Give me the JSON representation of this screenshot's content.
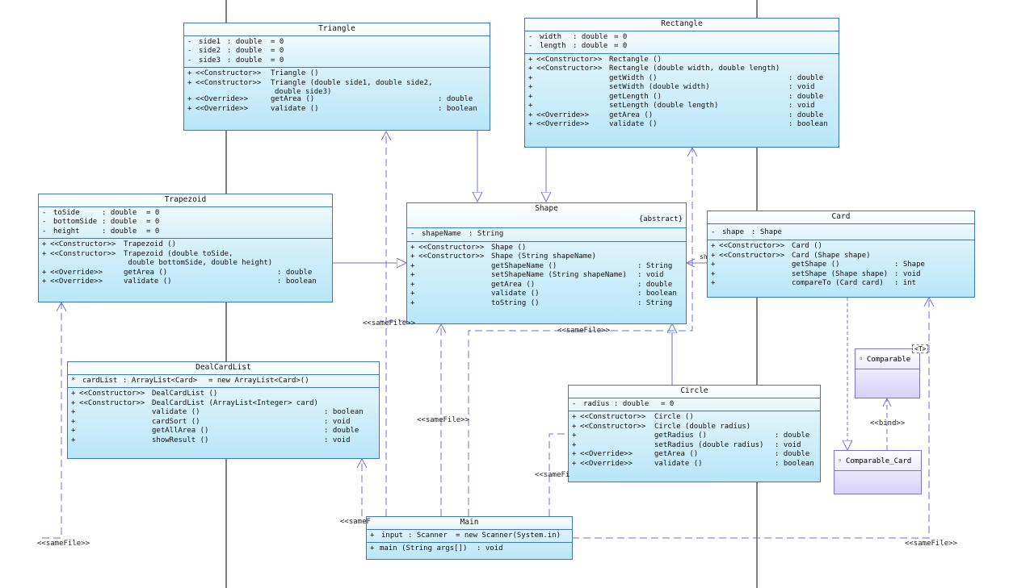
{
  "classes": {
    "triangle": {
      "name": "Triangle",
      "attributes": [
        {
          "vis": "-",
          "name": "side1",
          "type": ": double",
          "init": "= 0"
        },
        {
          "vis": "-",
          "name": "side2",
          "type": ": double",
          "init": "= 0"
        },
        {
          "vis": "-",
          "name": "side3",
          "type": ": double",
          "init": "= 0"
        }
      ],
      "operations": [
        {
          "vis": "+",
          "stereo": "<<Constructor>>",
          "sig": "Triangle ()",
          "ret": ""
        },
        {
          "vis": "+",
          "stereo": "<<Constructor>>",
          "sig": "Triangle (double side1, double side2,",
          "ret": ""
        },
        {
          "vis": "",
          "stereo": "",
          "sig": "double side3)",
          "ret": ""
        },
        {
          "vis": "+",
          "stereo": "<<Override>>",
          "sig": "getArea ()",
          "ret": ": double"
        },
        {
          "vis": "+",
          "stereo": "<<Override>>",
          "sig": "validate ()",
          "ret": ": boolean"
        }
      ]
    },
    "rectangle": {
      "name": "Rectangle",
      "attributes": [
        {
          "vis": "-",
          "name": "width",
          "type": ": double",
          "init": "= 0"
        },
        {
          "vis": "-",
          "name": "length",
          "type": ": double",
          "init": "= 0"
        }
      ],
      "operations": [
        {
          "vis": "+",
          "stereo": "<<Constructor>>",
          "sig": "Rectangle ()",
          "ret": ""
        },
        {
          "vis": "+",
          "stereo": "<<Constructor>>",
          "sig": "Rectangle (double width, double length)",
          "ret": ""
        },
        {
          "vis": "+",
          "stereo": "",
          "sig": "getWidth ()",
          "ret": ": double"
        },
        {
          "vis": "+",
          "stereo": "",
          "sig": "setWidth (double width)",
          "ret": ": void"
        },
        {
          "vis": "+",
          "stereo": "",
          "sig": "getLength ()",
          "ret": ": double"
        },
        {
          "vis": "+",
          "stereo": "",
          "sig": "setLength (double length)",
          "ret": ": void"
        },
        {
          "vis": "+",
          "stereo": "<<Override>>",
          "sig": "getArea ()",
          "ret": ": double"
        },
        {
          "vis": "+",
          "stereo": "<<Override>>",
          "sig": "validate ()",
          "ret": ": boolean"
        }
      ]
    },
    "trapezoid": {
      "name": "Trapezoid",
      "attributes": [
        {
          "vis": "-",
          "name": "toSide",
          "type": ": double",
          "init": "= 0"
        },
        {
          "vis": "-",
          "name": "bottomSide",
          "type": ": double",
          "init": "= 0"
        },
        {
          "vis": "-",
          "name": "height",
          "type": ": double",
          "init": "= 0"
        }
      ],
      "operations": [
        {
          "vis": "+",
          "stereo": "<<Constructor>>",
          "sig": "Trapezoid ()",
          "ret": ""
        },
        {
          "vis": "+",
          "stereo": "<<Constructor>>",
          "sig": "Trapezoid (double toSide,",
          "ret": ""
        },
        {
          "vis": "",
          "stereo": "",
          "sig": " double bottomSide, double height)",
          "ret": ""
        },
        {
          "vis": "+",
          "stereo": "<<Override>>",
          "sig": "getArea ()",
          "ret": ": double"
        },
        {
          "vis": "+",
          "stereo": "<<Override>>",
          "sig": "validate ()",
          "ret": ": boolean"
        }
      ]
    },
    "shape": {
      "name": "Shape",
      "abstract": "{abstract}",
      "attributes": [
        {
          "vis": "-",
          "name": "shapeName",
          "type": ": String",
          "init": ""
        }
      ],
      "operations": [
        {
          "vis": "+",
          "stereo": "<<Constructor>>",
          "sig": "Shape ()",
          "ret": ""
        },
        {
          "vis": "+",
          "stereo": "<<Constructor>>",
          "sig": "Shape (String shapeName)",
          "ret": ""
        },
        {
          "vis": "+",
          "stereo": "",
          "sig": "getShapeName ()",
          "ret": ": String"
        },
        {
          "vis": "+",
          "stereo": "",
          "sig": "setShapeName (String shapeName)",
          "ret": ": void"
        },
        {
          "vis": "+",
          "stereo": "",
          "sig": "getArea ()",
          "ret": ": double"
        },
        {
          "vis": "+",
          "stereo": "",
          "sig": "validate ()",
          "ret": ": boolean"
        },
        {
          "vis": "+",
          "stereo": "",
          "sig": "toString ()",
          "ret": ": String"
        }
      ]
    },
    "card": {
      "name": "Card",
      "attributes": [
        {
          "vis": "-",
          "name": "shape",
          "type": ": Shape",
          "init": ""
        }
      ],
      "operations": [
        {
          "vis": "+",
          "stereo": "<<Constructor>>",
          "sig": "Card ()",
          "ret": ""
        },
        {
          "vis": "+",
          "stereo": "<<Constructor>>",
          "sig": "Card (Shape shape)",
          "ret": ""
        },
        {
          "vis": "+",
          "stereo": "",
          "sig": "getShape ()",
          "ret": ": Shape"
        },
        {
          "vis": "+",
          "stereo": "",
          "sig": "setShape (Shape shape)",
          "ret": ": void"
        },
        {
          "vis": "+",
          "stereo": "",
          "sig": "compareTo (Card card)",
          "ret": ": int"
        }
      ]
    },
    "dealcardlist": {
      "name": "DealCardList",
      "attributes": [
        {
          "vis": "*",
          "name": "cardList",
          "type": ": ArrayList<Card>",
          "init": "= new ArrayList<Card>()"
        }
      ],
      "operations": [
        {
          "vis": "+",
          "stereo": "<<Constructor>>",
          "sig": "DealCardList ()",
          "ret": ""
        },
        {
          "vis": "+",
          "stereo": "<<Constructor>>",
          "sig": "DealCardList (ArrayList<Integer> card)",
          "ret": ""
        },
        {
          "vis": "+",
          "stereo": "",
          "sig": "validate ()",
          "ret": ": boolean"
        },
        {
          "vis": "+",
          "stereo": "",
          "sig": "cardSort ()",
          "ret": ": void"
        },
        {
          "vis": "+",
          "stereo": "",
          "sig": "getAllArea ()",
          "ret": ": double"
        },
        {
          "vis": "+",
          "stereo": "",
          "sig": "showResult ()",
          "ret": ": void"
        }
      ]
    },
    "circle": {
      "name": "Circle",
      "attributes": [
        {
          "vis": "-",
          "name": "radius",
          "type": ": double",
          "init": "= 0"
        }
      ],
      "operations": [
        {
          "vis": "+",
          "stereo": "<<Constructor>>",
          "sig": "Circle ()",
          "ret": ""
        },
        {
          "vis": "+",
          "stereo": "<<Constructor>>",
          "sig": "Circle (double radius)",
          "ret": ""
        },
        {
          "vis": "+",
          "stereo": "",
          "sig": "getRadius ()",
          "ret": ": double"
        },
        {
          "vis": "+",
          "stereo": "",
          "sig": "setRadius (double radius)",
          "ret": ": void"
        },
        {
          "vis": "+",
          "stereo": "<<Override>>",
          "sig": "getArea ()",
          "ret": ": double"
        },
        {
          "vis": "+",
          "stereo": "<<Override>>",
          "sig": "validate ()",
          "ret": ": boolean"
        }
      ]
    },
    "main": {
      "name": "Main",
      "attributes": [
        {
          "vis": "+",
          "name": "input",
          "type": ": Scanner",
          "init": "= new Scanner(System.in)"
        }
      ],
      "operations": [
        {
          "vis": "+",
          "stereo": "",
          "sig": "main (String args[])",
          "ret": ": void"
        }
      ]
    }
  },
  "interfaces": {
    "comparable": {
      "name": "Comparable",
      "type_param": "<T>"
    },
    "comparable_card": {
      "name": "Comparable_Card"
    }
  },
  "labels": {
    "same_file": "<<sameFile>>",
    "bind": "<<bind>>",
    "same_file_partial": "<<sameF",
    "same_file_partial2": "<<sameFi",
    "assoc_role": "sh"
  },
  "colors": {
    "class_border": "#3a78b8",
    "class_fill": "#b8e6f8",
    "interface_border": "#7f6fd0",
    "line": "#6f6fd8"
  }
}
